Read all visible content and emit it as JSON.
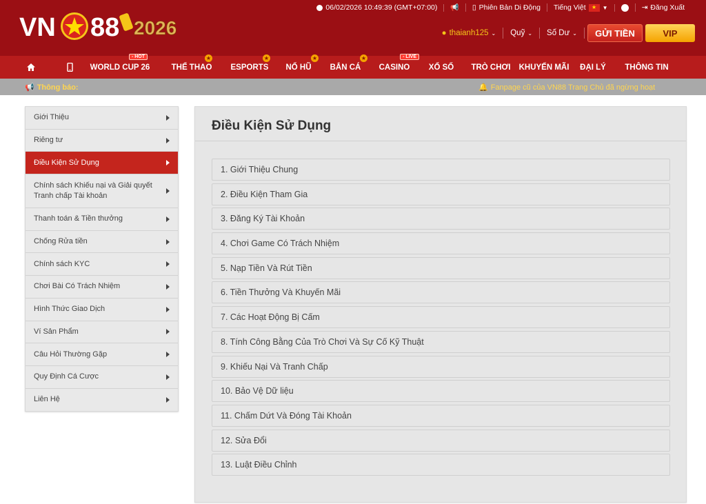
{
  "brand": {
    "logo_text": "VN88",
    "logo_year": "2026"
  },
  "topbar": {
    "datetime": "06/02/2026 10:49:39 (GMT+07:00)",
    "mobile_version": "Phiên Bản Di Động",
    "language": "Tiếng Việt",
    "logout": "Đăng Xuất"
  },
  "userbar": {
    "username": "thaianh125",
    "fund": "Quỹ",
    "balance": "Số Dư",
    "deposit_button": "GỬI TIỀN",
    "vip_button": "VIP"
  },
  "nav": {
    "items": [
      {
        "label": "WORLD CUP 26",
        "badge": "- HOT"
      },
      {
        "label": "THỂ THAO",
        "badge": "★"
      },
      {
        "label": "ESPORTS",
        "badge": "★"
      },
      {
        "label": "NỔ HŨ",
        "badge": "★"
      },
      {
        "label": "BẮN CÁ",
        "badge": "★"
      },
      {
        "label": "CASINO",
        "badge": "- LIVE"
      },
      {
        "label": "XỔ SỐ"
      },
      {
        "label": "TRÒ CHƠI"
      },
      {
        "label": "KHUYẾN MÃI"
      },
      {
        "label": "ĐẠI LÝ"
      },
      {
        "label": "THÔNG TIN"
      }
    ]
  },
  "notice": {
    "label": "Thông báo:",
    "message": "Fanpage cũ của VN88 Trang Chủ đã ngừng hoạt"
  },
  "sidebar": {
    "items": [
      {
        "label": "Giới Thiệu"
      },
      {
        "label": "Riêng tư"
      },
      {
        "label": "Điều Kiện Sử Dụng",
        "active": true
      },
      {
        "label": "Chính sách Khiếu nại và Giải quyết Tranh chấp Tài khoản"
      },
      {
        "label": "Thanh toán & Tiền thưởng"
      },
      {
        "label": "Chống Rửa tiền"
      },
      {
        "label": "Chính sách KYC"
      },
      {
        "label": "Chơi Bài Có Trách Nhiệm"
      },
      {
        "label": "Hình Thức Giao Dịch"
      },
      {
        "label": "Ví Sản Phẩm"
      },
      {
        "label": "Câu Hỏi Thường Gặp"
      },
      {
        "label": "Quy Định Cá Cược"
      },
      {
        "label": "Liên Hệ"
      }
    ]
  },
  "main": {
    "title": "Điều Kiện Sử Dụng",
    "sections": [
      "1. Giới Thiệu Chung",
      "2. Điều Kiện Tham Gia",
      "3. Đăng Ký Tài Khoản",
      "4. Chơi Game Có Trách Nhiệm",
      "5. Nạp Tiền Và Rút Tiền",
      "6. Tiền Thưởng Và Khuyến Mãi",
      "7. Các Hoạt Động Bị Cấm",
      "8. Tính Công Bằng Của Trò Chơi Và Sự Cố Kỹ Thuật",
      "9. Khiếu Nại Và Tranh Chấp",
      "10. Bảo Vệ Dữ liệu",
      "11. Chấm Dứt Và Đóng Tài Khoản",
      "12. Sửa Đổi",
      "13. Luật Điều Chỉnh"
    ]
  },
  "colors": {
    "header_bg": "#9b0f14",
    "nav_bg": "#b71c1c",
    "active_item": "#c4251d",
    "accent_gold": "#f5a300"
  }
}
